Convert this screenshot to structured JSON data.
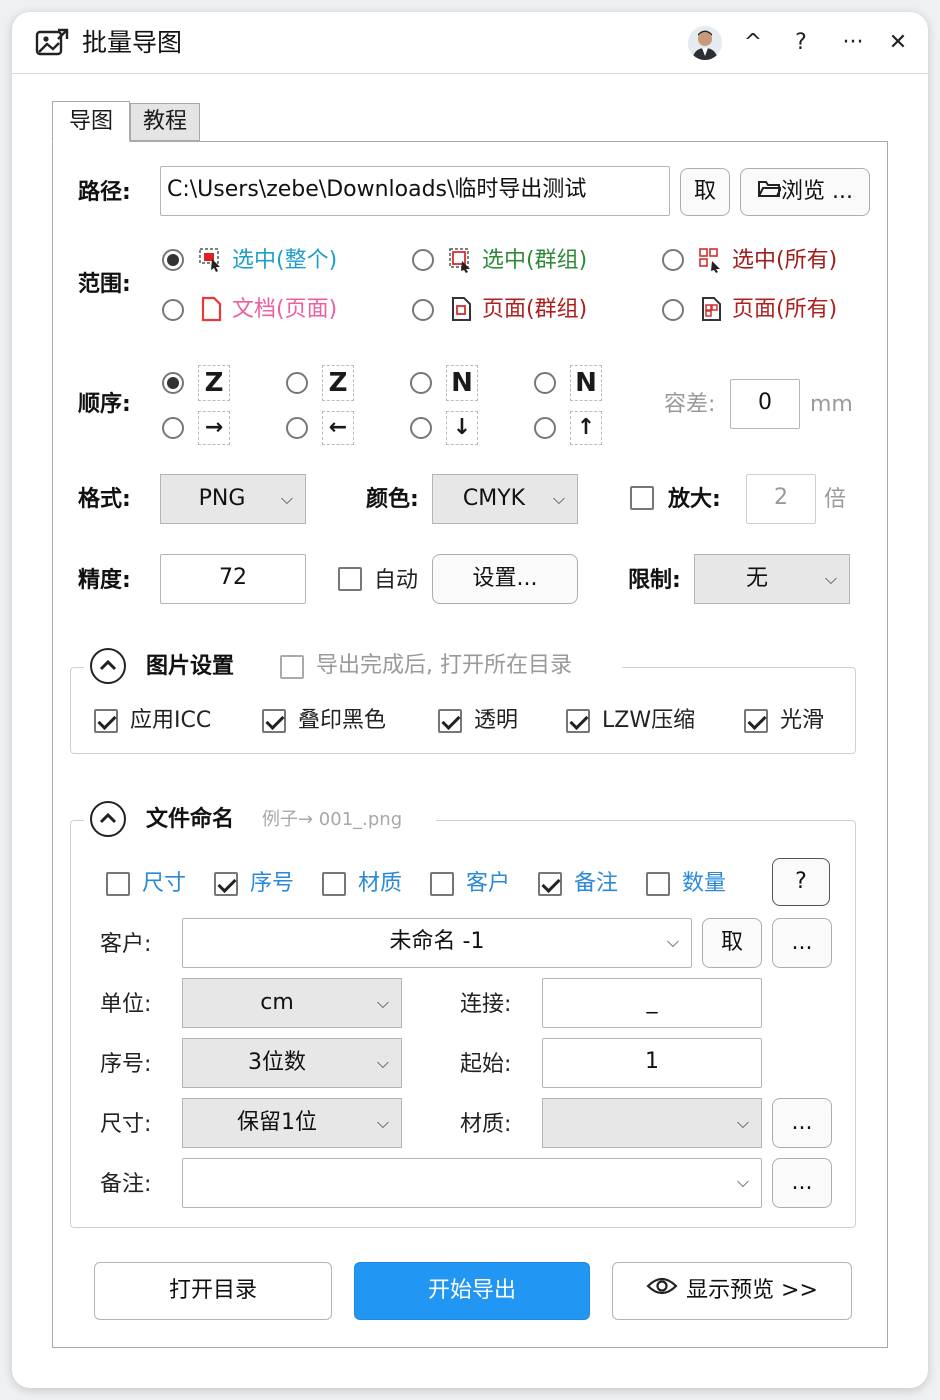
{
  "window": {
    "title": "批量导图"
  },
  "titlebar": {
    "collapse": "^",
    "help": "?",
    "more": "···",
    "close": "✕"
  },
  "tabs": [
    {
      "label": "导图"
    },
    {
      "label": "教程"
    }
  ],
  "path": {
    "label": "路径:",
    "value": "C:\\Users\\zebe\\Downloads\\临时导出测试",
    "take_button": "取",
    "browse_button": "浏览 ..."
  },
  "scope": {
    "label": "范围:",
    "options": [
      {
        "text": "选中(整个)",
        "color": "#1f9ec8"
      },
      {
        "text": "选中(群组)",
        "color": "#2f8a3a"
      },
      {
        "text": "选中(所有)",
        "color": "#a11c1c"
      },
      {
        "text": "文档(页面)",
        "color": "#ec5fa0"
      },
      {
        "text": "页面(群组)",
        "color": "#b01f1f"
      },
      {
        "text": "页面(所有)",
        "color": "#b01f1f"
      }
    ]
  },
  "order": {
    "label": "顺序:",
    "glyphs": [
      "Z",
      "Z",
      "N",
      "N",
      "→",
      "←",
      "↓",
      "↑"
    ],
    "tolerance_label": "容差:",
    "tolerance_value": "0",
    "tolerance_unit": "mm"
  },
  "format": {
    "label": "格式:",
    "value": "PNG"
  },
  "color": {
    "label": "颜色:",
    "value": "CMYK"
  },
  "zoom": {
    "label": "放大:",
    "value": "2",
    "unit": "倍"
  },
  "precision": {
    "label": "精度:",
    "value": "72",
    "auto_label": "自动",
    "settings_button": "设置...",
    "limit_label": "限制:",
    "limit_value": "无"
  },
  "image_settings": {
    "title": "图片设置",
    "open_after": "导出完成后, 打开所在目录",
    "options": [
      "应用ICC",
      "叠印黑色",
      "透明",
      "LZW压缩",
      "光滑"
    ]
  },
  "file_naming": {
    "title": "文件命名",
    "example": "例子→ 001_.png",
    "tags": [
      "尺寸",
      "序号",
      "材质",
      "客户",
      "备注",
      "数量"
    ],
    "help_button": "?",
    "customer_label": "客户:",
    "customer_value": "未命名 -1",
    "take_button": "取",
    "more_button": "...",
    "unit_label": "单位:",
    "unit_value": "cm",
    "connect_label": "连接:",
    "connect_value": "_",
    "serial_label": "序号:",
    "serial_value": "3位数",
    "start_label": "起始:",
    "start_value": "1",
    "size_label": "尺寸:",
    "size_value": "保留1位",
    "material_label": "材质:",
    "material_value": "",
    "note_label": "备注:",
    "note_value": ""
  },
  "footer": {
    "open_dir": "打开目录",
    "start_export": "开始导出",
    "preview": "显示预览 >>"
  },
  "colors": {
    "primary": "#2196f3",
    "blue_text": "#2a8ad8"
  }
}
